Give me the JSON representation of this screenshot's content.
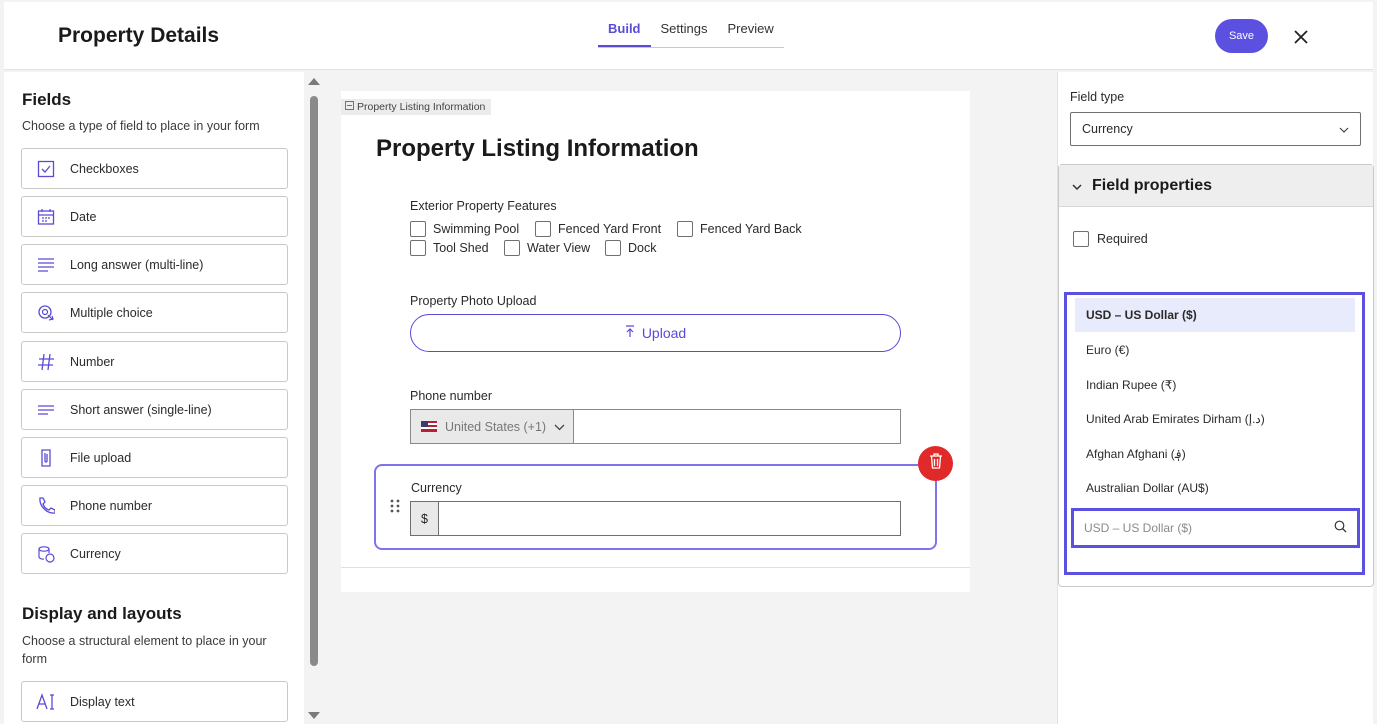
{
  "header": {
    "title": "Property Details",
    "tabs": [
      {
        "label": "Build",
        "active": true
      },
      {
        "label": "Settings",
        "active": false
      },
      {
        "label": "Preview",
        "active": false
      }
    ],
    "save_label": "Save"
  },
  "sidebar": {
    "fields_title": "Fields",
    "fields_subtitle": "Choose a type of field to place in your form",
    "items": [
      {
        "label": "Checkboxes",
        "icon": "checkbox-icon"
      },
      {
        "label": "Date",
        "icon": "calendar-icon"
      },
      {
        "label": "Long answer (multi-line)",
        "icon": "long-text-icon"
      },
      {
        "label": "Multiple choice",
        "icon": "multiple-choice-icon"
      },
      {
        "label": "Number",
        "icon": "hash-icon"
      },
      {
        "label": "Short answer (single-line)",
        "icon": "short-text-icon"
      },
      {
        "label": "File upload",
        "icon": "file-icon"
      },
      {
        "label": "Phone number",
        "icon": "phone-icon"
      },
      {
        "label": "Currency",
        "icon": "coins-icon"
      }
    ],
    "layouts_title": "Display and layouts",
    "layouts_subtitle": "Choose a structural element to place in your form",
    "layout_items": [
      {
        "label": "Display text",
        "icon": "text-cursor-icon"
      }
    ]
  },
  "canvas": {
    "section_tag": "Property Listing Information",
    "section_title": "Property Listing Information",
    "features_label": "Exterior Property Features",
    "features": [
      "Swimming Pool",
      "Fenced Yard Front",
      "Fenced Yard Back",
      "Tool Shed",
      "Water View",
      "Dock"
    ],
    "photo_label": "Property Photo Upload",
    "upload_label": "Upload",
    "phone_label": "Phone number",
    "phone_country": "United States (+1)",
    "currency_label": "Currency",
    "currency_prefix": "$"
  },
  "right_panel": {
    "field_type_label": "Field type",
    "field_type_value": "Currency",
    "properties_title": "Field properties",
    "required_label": "Required",
    "currency_options": [
      "USD – US Dollar ($)",
      "Euro (€)",
      "Indian Rupee (₹)",
      "United Arab Emirates Dirham (د.إ)",
      "Afghan Afghani (؋)",
      "Australian Dollar (AU$)"
    ],
    "selected_option": "USD – US Dollar ($)",
    "search_placeholder": "USD – US Dollar ($)"
  },
  "colors": {
    "accent": "#5b50e0",
    "delete": "#e02a2a",
    "selected_bg": "#e8ebfb"
  }
}
